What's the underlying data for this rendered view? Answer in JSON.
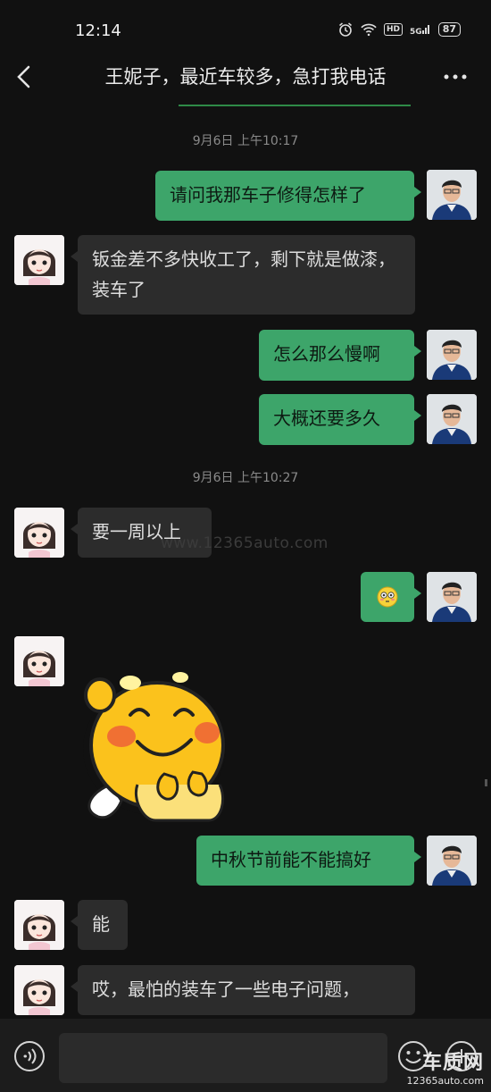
{
  "status_bar": {
    "time": "12:14",
    "hd": "HD",
    "signal": "5G",
    "battery": "87"
  },
  "header": {
    "title": "王妮子，最近车较多，急打我电话"
  },
  "messages": [
    {
      "type": "timestamp",
      "text": "9月6日 上午10:17"
    },
    {
      "type": "sent",
      "text": "请问我那车子修得怎样了"
    },
    {
      "type": "received",
      "text": "钣金差不多快收工了，剩下就是做漆，装车了"
    },
    {
      "type": "sent",
      "text": "怎么那么慢啊"
    },
    {
      "type": "sent",
      "text": "大概还要多久"
    },
    {
      "type": "timestamp",
      "text": "9月6日 上午10:27"
    },
    {
      "type": "received",
      "text": "要一周以上"
    },
    {
      "type": "sent",
      "emoji": "flushed-face"
    },
    {
      "type": "received",
      "sticker": "smiling-yellow-mascot"
    },
    {
      "type": "sent",
      "text": "中秋节前能不能搞好"
    },
    {
      "type": "received",
      "text": "能"
    },
    {
      "type": "received",
      "text": "哎，最怕的装车了一些电子问题，"
    }
  ],
  "watermark": "www.12365auto.com",
  "logo": {
    "main": "车质网",
    "sub": "12365auto.com"
  },
  "colors": {
    "sent_bubble": "#3da56a",
    "received_bubble": "#2c2c2c",
    "background": "#111111",
    "accent_line": "#2e8a47"
  }
}
